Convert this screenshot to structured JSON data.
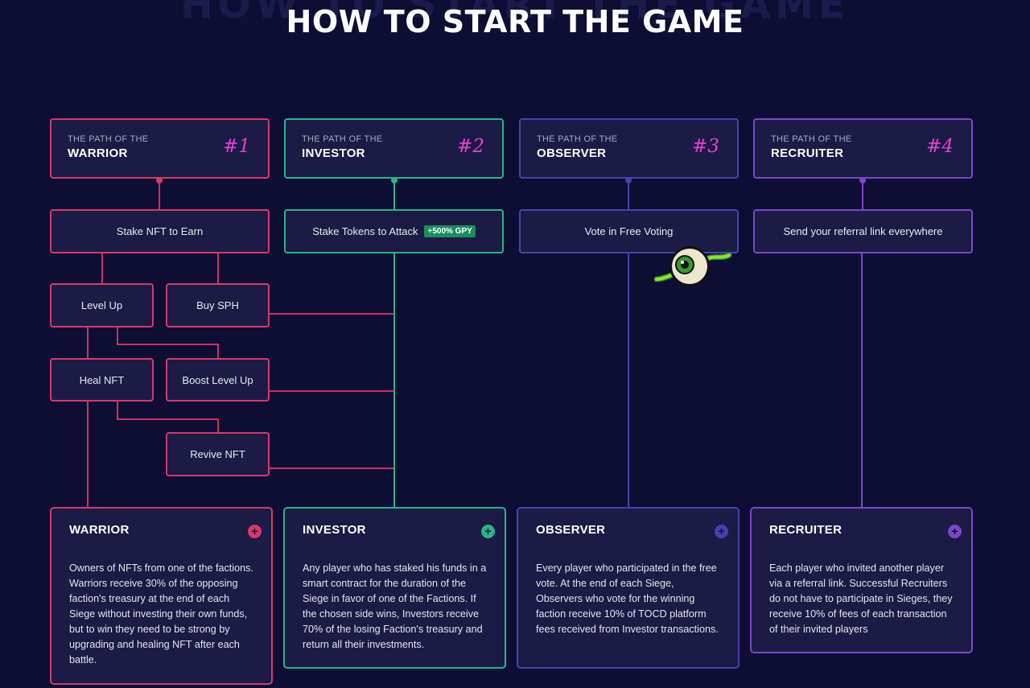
{
  "page": {
    "ghost_title": "HOW TO START THE GAME",
    "title": "HOW TO START THE GAME"
  },
  "paths": [
    {
      "prefix": "THE PATH OF THE",
      "name": "WARRIOR",
      "number": "#1",
      "color": "#d33a68"
    },
    {
      "prefix": "THE PATH OF THE",
      "name": "INVESTOR",
      "number": "#2",
      "color": "#2ab386"
    },
    {
      "prefix": "THE PATH OF THE",
      "name": "OBSERVER",
      "number": "#3",
      "color": "#4a3fae"
    },
    {
      "prefix": "THE PATH OF THE",
      "name": "RECRUITER",
      "number": "#4",
      "color": "#7b45c8"
    }
  ],
  "steps": {
    "warrior_main": "Stake NFT to Earn",
    "investor_main": "Stake Tokens to Attack",
    "investor_badge": "+500% GPY",
    "observer_main": "Vote in Free Voting",
    "recruiter_main": "Send your referral link everywhere",
    "level_up": "Level Up",
    "buy_sph": "Buy SPH",
    "heal_nft": "Heal NFT",
    "boost_level_up": "Boost Level Up",
    "revive_nft": "Revive NFT"
  },
  "cards": [
    {
      "title": "WARRIOR",
      "icon": "plus-icon",
      "color": "#d33a68",
      "text": "Owners of NFTs from one of the factions. Warriors receive 30% of the opposing faction's treasury at the end of each Siege without investing their own funds, but to win they need to be strong by upgrading and healing NFT after each battle."
    },
    {
      "title": "INVESTOR",
      "icon": "plus-icon",
      "color": "#2ab386",
      "text": "Any player who has staked his funds in a smart contract for the duration of the Siege in favor of one of the Factions. If the chosen side wins, Investors receive 70% of the losing Faction's treasury and return all their investments."
    },
    {
      "title": "OBSERVER",
      "icon": "plus-icon",
      "color": "#4a3fae",
      "text": "Every player who participated in the free vote. At the end of each Siege, Observers who vote for the winning faction receive 10% of TOCD platform fees received from Investor transactions."
    },
    {
      "title": "RECRUITER",
      "icon": "plus-icon",
      "color": "#7b45c8",
      "text": "Each player who invited another player via a referral link. Successful Recruiters do not have to participate in Sieges, they receive 10% of fees of each transaction of their invited players"
    }
  ],
  "decor": {
    "mascot": "eyeball-mascot-icon"
  }
}
